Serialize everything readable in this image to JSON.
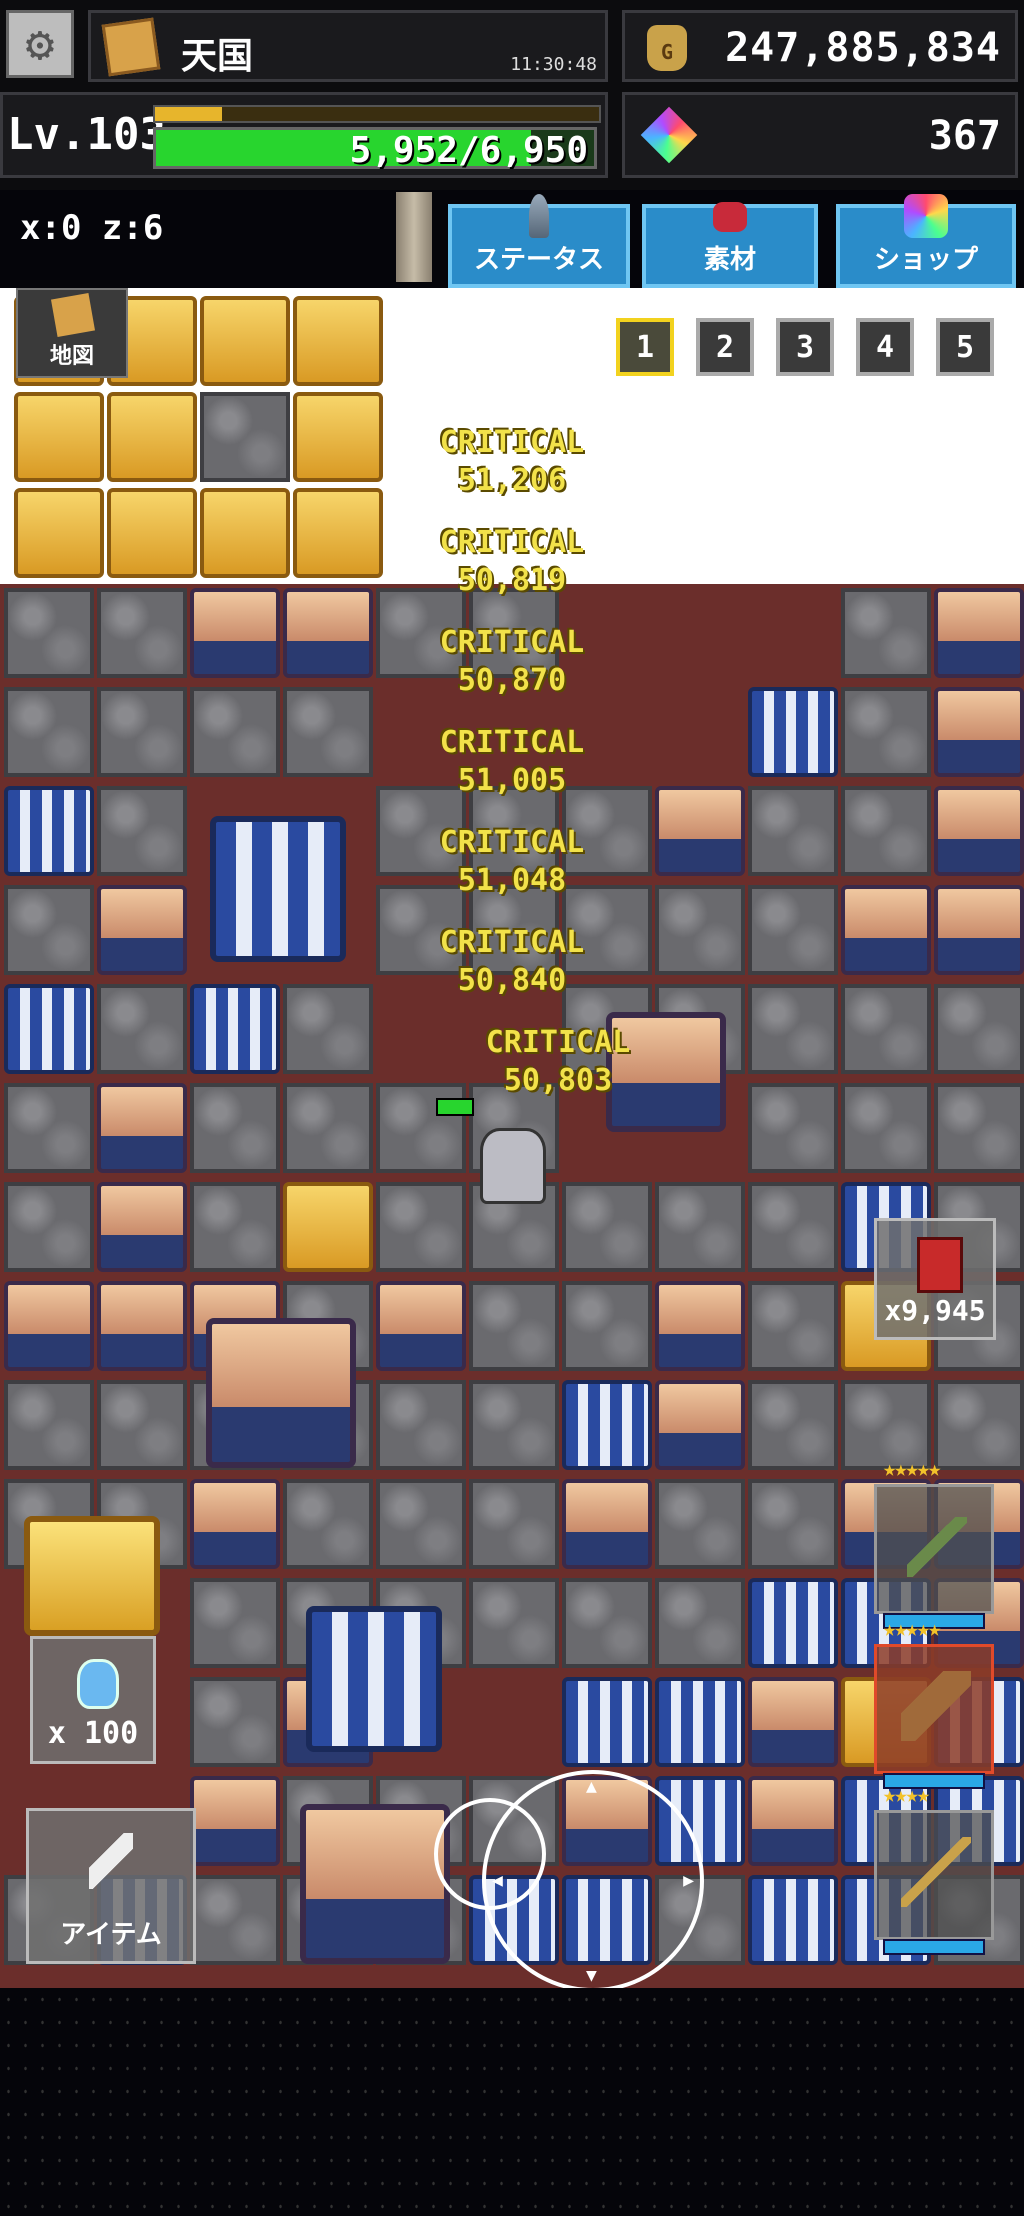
{
  "header": {
    "settings_icon": "gear-icon",
    "area_name": "天国",
    "clock": "11:30:48",
    "gold_amount": "247,885,834",
    "gem_amount": "367",
    "level_label": "Lv.103",
    "xp_progress": 0.15,
    "hp_text": "5,952/6,950",
    "hp_progress": 0.856
  },
  "position": {
    "coords": "x:0 z:6"
  },
  "menu": {
    "status": "ステータス",
    "materials": "素材",
    "shop": "ショップ",
    "map": "地図"
  },
  "pages": [
    "1",
    "2",
    "3",
    "4",
    "5"
  ],
  "active_page": "1",
  "damage_popups": [
    {
      "label": "CRITICAL",
      "value": "51,206"
    },
    {
      "label": "CRITICAL",
      "value": "50,819"
    },
    {
      "label": "CRITICAL",
      "value": "50,870"
    },
    {
      "label": "CRITICAL",
      "value": "51,005"
    },
    {
      "label": "CRITICAL",
      "value": "51,048"
    },
    {
      "label": "CRITICAL",
      "value": "50,840"
    },
    {
      "label": "CRITICAL",
      "value": "50,803"
    }
  ],
  "hud": {
    "bomb_count": "x9,945",
    "potion_count": "x 100",
    "item_button": "アイテム"
  },
  "equipment_slots": [
    {
      "stars": "★★★★★",
      "icon": "sword-icon"
    },
    {
      "stars": "★★★★★",
      "icon": "club-icon"
    },
    {
      "stars": "★★★★",
      "icon": "staff-icon"
    }
  ],
  "colors": {
    "gold": "#e7b52c",
    "hp": "#28d52e",
    "tab": "#2a8cc9",
    "critical": "#f2e24a",
    "active_page": "#f2d21e"
  }
}
